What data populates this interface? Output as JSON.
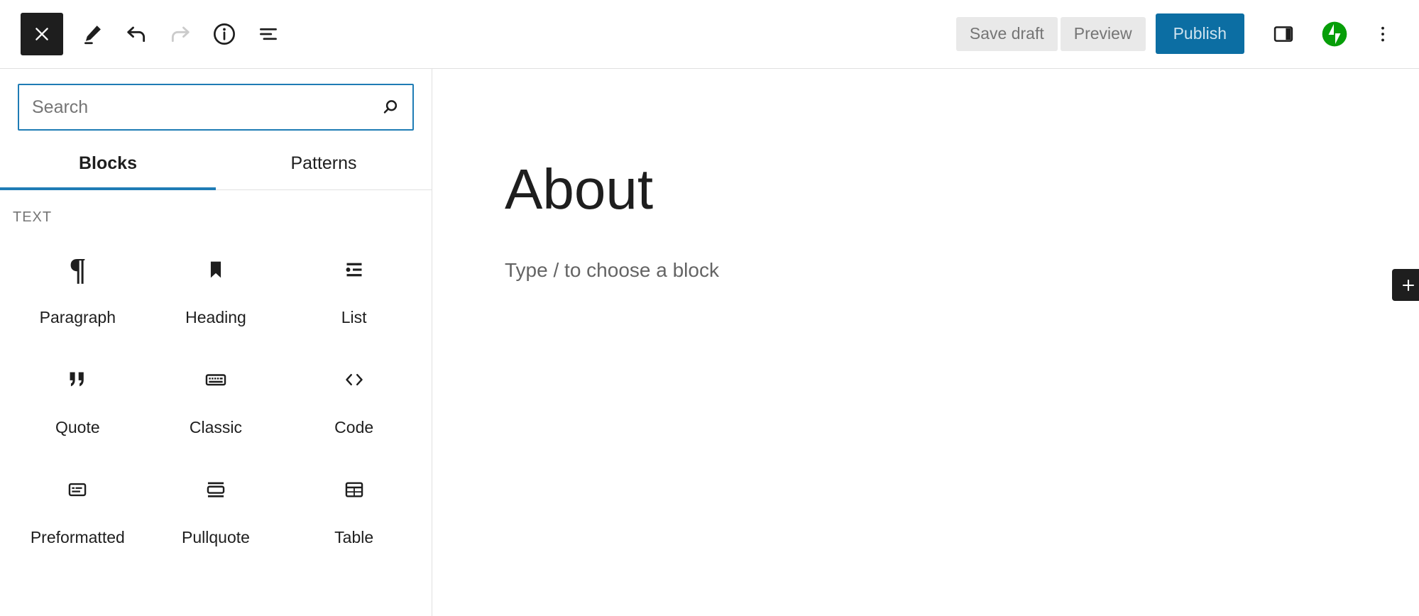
{
  "toolbar": {
    "close_label": "Close",
    "edit_label": "Edit",
    "undo_label": "Undo",
    "redo_label": "Redo",
    "details_label": "Details",
    "list_view_label": "List View",
    "save_draft_label": "Save draft",
    "preview_label": "Preview",
    "publish_label": "Publish",
    "settings_label": "Settings",
    "jetpack_label": "Jetpack",
    "options_label": "Options",
    "publish_color": "#0c6ea3",
    "jetpack_color": "#069e08",
    "close_bg_color": "#1e1e1e"
  },
  "inserter": {
    "search": {
      "value": "",
      "placeholder": "Search"
    },
    "tabs": [
      {
        "label": "Blocks",
        "active": true
      },
      {
        "label": "Patterns",
        "active": false
      }
    ],
    "active_tab_color": "#1f7cb5",
    "sections": [
      {
        "title": "TEXT",
        "blocks": [
          {
            "label": "Paragraph",
            "icon": "paragraph-icon"
          },
          {
            "label": "Heading",
            "icon": "heading-icon"
          },
          {
            "label": "List",
            "icon": "list-icon"
          },
          {
            "label": "Quote",
            "icon": "quote-icon"
          },
          {
            "label": "Classic",
            "icon": "classic-icon"
          },
          {
            "label": "Code",
            "icon": "code-icon"
          },
          {
            "label": "Preformatted",
            "icon": "preformatted-icon"
          },
          {
            "label": "Pullquote",
            "icon": "pullquote-icon"
          },
          {
            "label": "Table",
            "icon": "table-icon"
          }
        ]
      }
    ]
  },
  "editor": {
    "post_title": "About",
    "block_prompt": "Type / to choose a block",
    "add_block_label": "+"
  }
}
